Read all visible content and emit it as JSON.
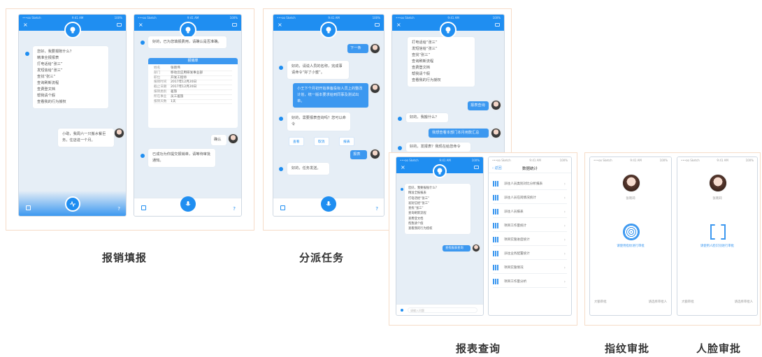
{
  "captions": {
    "reimburse": "报销填报",
    "assign": "分派任务",
    "report": "报表查询",
    "fingerprint": "指纹审批",
    "face": "人脸审批"
  },
  "status": {
    "carrier": "•••oo Sketch",
    "time": "9:41 AM",
    "battery": "100%"
  },
  "p1": {
    "greeting": "您好，我要报账什么？",
    "menu": [
      "精准全报报表",
      "打电话给“张三”",
      "发短信给“张三”",
      "查找“张三”",
      "查询刷新流程",
      "查费登文档",
      "帮我请个假",
      "查看我的行为授权"
    ],
    "user_msg": "小助，我周六一只搬水餐巨务，住店进一个月。"
  },
  "p2": {
    "reply": "好的，已为您填报费用，请确认是否准确。",
    "card_title": "报销单",
    "rows": [
      {
        "k": "姓名",
        "v": "张晓伟"
      },
      {
        "k": "部门",
        "v": "移动云应用研发事业部"
      },
      {
        "k": "职位",
        "v": "开发工程师"
      },
      {
        "k": "报销时间",
        "v": "2017年12月20日"
      },
      {
        "k": "截止日期",
        "v": "2017年12月20日"
      },
      {
        "k": "报销类别",
        "v": "差旅"
      },
      {
        "k": "所在事业",
        "v": "员工差旅"
      },
      {
        "k": "报销天数",
        "v": "1天"
      }
    ],
    "confirm": "确认",
    "done": "已成功为你提交报销单，请等待审批通知。"
  },
  "p3": {
    "me1": "下一条",
    "bot1": "好的，请说人员的名称，完成事请命令“好了小蜜”。",
    "me2": "小王下个月初开始准备投标人员上的整改计划，统一版本要求给到同事及测试出单。",
    "bot2": "好的，需要报表查询吗？您可以命令",
    "btns": [
      "查看",
      "取消",
      "报表"
    ],
    "me3": "报表",
    "bot3": "好的，任务发送。"
  },
  "p4": {
    "menu": [
      "打电话给“张三”",
      "发短信给“张三”",
      "查找“张三”",
      "查询刷新流程",
      "查费登文档",
      "帮我请个假",
      "查看我的行为授权"
    ],
    "me1": "报表查询",
    "bot1": "好的，我搬什么？",
    "me2": "我想查看本部门本月用款汇总",
    "bot2": "好的，发报表？我现在给您命令"
  },
  "p5": {
    "greeting": "您好，我要报账什么？",
    "menu": [
      "精准全报报表",
      "打电话给“张三”",
      "发短信给“张三”",
      "查找“张三”",
      "查询刷新流程",
      "查费登文档",
      "帮我请个假",
      "查看我的行为授权"
    ],
    "me1": "查找报表查询",
    "input_placeholder": "请输入问题"
  },
  "p6": {
    "back": "返回",
    "title": "数据统计",
    "rows": [
      "派往人员类别对比分析报表",
      "派往人员在岗情况统计",
      "派往人员报表",
      "项目工作量统计",
      "项目实施进度统计",
      "派往业务配置统计",
      "项目实施情况",
      "项目工作量分析"
    ]
  },
  "p7": {
    "name": "张晓莉",
    "link": "请使用指纹进行审批",
    "left": "大额审批",
    "right": "请选择审批人"
  },
  "p8": {
    "name": "张晓莉",
    "link": "请使用人脸识别进行审批",
    "left": "大额审批",
    "right": "请选择审批人"
  },
  "colors": {
    "accent": "#1f8ef1",
    "bubble_me": "#3c98f0",
    "frame": "#f6dcc8"
  },
  "icons": [
    "bulb-icon",
    "mic-icon",
    "close-icon",
    "menu-icon",
    "keyboard-icon",
    "help-icon",
    "chart-bar-icon",
    "fingerprint-icon",
    "face-id-icon",
    "chevron-right-icon"
  ]
}
